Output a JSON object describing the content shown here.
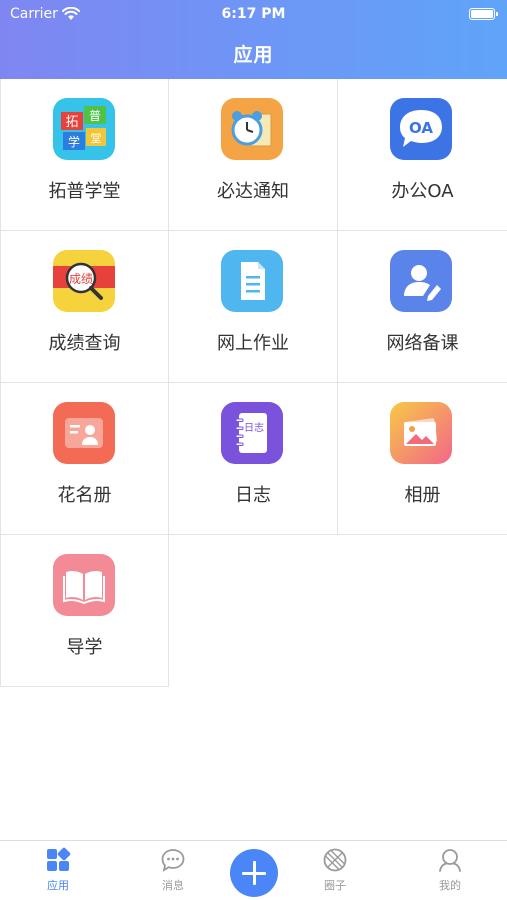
{
  "status_bar": {
    "carrier": "Carrier",
    "time": "6:17 PM"
  },
  "header": {
    "title": "应用"
  },
  "apps": [
    {
      "label": "拓普学堂",
      "icon": "tuopu-icon"
    },
    {
      "label": "必达通知",
      "icon": "alarm-clock-icon"
    },
    {
      "label": "办公OA",
      "icon": "oa-chat-icon",
      "icon_text": "OA"
    },
    {
      "label": "成绩查询",
      "icon": "grade-search-icon",
      "icon_text": "成绩"
    },
    {
      "label": "网上作业",
      "icon": "document-icon"
    },
    {
      "label": "网络备课",
      "icon": "user-edit-icon"
    },
    {
      "label": "花名册",
      "icon": "roster-icon"
    },
    {
      "label": "日志",
      "icon": "notebook-icon",
      "icon_text": "日志"
    },
    {
      "label": "相册",
      "icon": "photo-album-icon"
    },
    {
      "label": "导学",
      "icon": "open-book-icon"
    }
  ],
  "tabbar": {
    "items": [
      {
        "label": "应用",
        "icon": "apps-grid-icon",
        "active": true
      },
      {
        "label": "消息",
        "icon": "chat-bubble-icon",
        "active": false
      },
      {
        "label": "",
        "icon": "plus-icon",
        "active": false
      },
      {
        "label": "圈子",
        "icon": "aperture-icon",
        "active": false
      },
      {
        "label": "我的",
        "icon": "profile-icon",
        "active": false
      }
    ]
  },
  "colors": {
    "accent": "#4a86f7",
    "header_start": "#7f86f2",
    "header_end": "#5fa4f8"
  }
}
